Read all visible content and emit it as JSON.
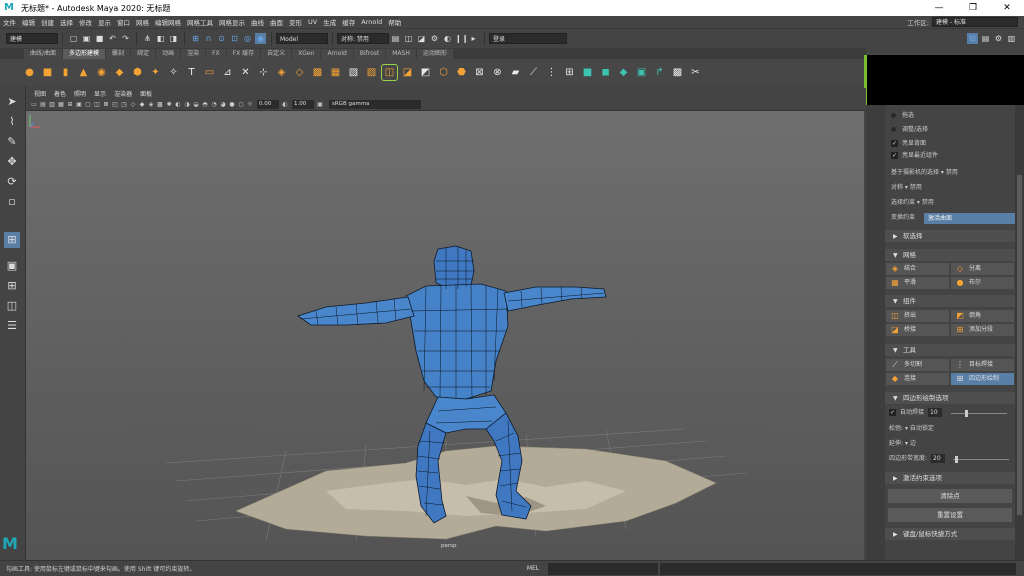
{
  "window": {
    "title": "无标题* - Autodesk Maya 2020: 无标题",
    "logo": "M",
    "minimize": "—",
    "maximize": "❐",
    "close": "✕"
  },
  "menu": [
    "文件",
    "编辑",
    "创建",
    "选择",
    "修改",
    "显示",
    "窗口",
    "网格",
    "编辑网格",
    "网格工具",
    "网格显示",
    "曲线",
    "曲面",
    "变形",
    "UV",
    "生成",
    "缓存",
    "Arnold",
    "帮助"
  ],
  "workspace": {
    "label": "工作区:",
    "value": "建模 - 标准"
  },
  "statusline": {
    "mode": "建模",
    "object_field": "Model",
    "symmetry": "对称: 禁用",
    "login": "登录"
  },
  "shelf_tabs": [
    "曲线/曲面",
    "多边形建模",
    "雕刻",
    "绑定",
    "动画",
    "渲染",
    "FX",
    "FX 缓存",
    "自定义",
    "XGen",
    "Arnold",
    "Bifrost",
    "MASH",
    "运动图形"
  ],
  "active_shelf_tab": 1,
  "viewport": {
    "menu": [
      "视图",
      "着色",
      "照明",
      "显示",
      "渲染器",
      "面板"
    ],
    "field1": "0.00",
    "field2": "1.00",
    "colorspace": "sRGB gamma",
    "camera_label": "persp"
  },
  "panel": {
    "pick_label": "拖选",
    "tweak_label": "调整/选择",
    "highlight_back": "亮显背面",
    "highlight_nearest": "亮显最近组件",
    "camera_select": "基于摄影机的选择",
    "camera_select_val": "禁用",
    "symmetry": "对称",
    "symmetry_val": "禁用",
    "constraint": "选择约束",
    "constraint_val": "禁用",
    "transform_constraint": "变换约束",
    "transform_val": "激活曲面",
    "soft_select": "软选择",
    "section_mesh": "网格",
    "combine": "结合",
    "separate": "分离",
    "smooth": "平滑",
    "boolean": "布尔",
    "section_components": "组件",
    "extrude": "挤出",
    "bevel": "倒角",
    "bridge": "桥接",
    "add_divisions": "添加分段",
    "section_tools": "工具",
    "multicut": "多切割",
    "target_weld": "目标焊接",
    "connect": "连接",
    "quad_draw": "四边形绘制",
    "quad_draw_options": "四边形绘制选项",
    "auto_weld": "自动焊接",
    "auto_weld_val": "10",
    "relax": "松弛:",
    "relax_val": "自动锁定",
    "extend": "延伸:",
    "extend_val": "边",
    "strip_width": "四边形带宽度:",
    "strip_width_val": "20",
    "activation_options": "激活约束选项",
    "clear_points": "清除点",
    "reset_settings": "重置设置",
    "hotkeys": "键盘/鼠标快捷方式"
  },
  "cmdline": {
    "help": "勾画工具: 使用鼠标左键或鼠标中键来勾画。使用 Shift 键可约束旋转。",
    "lang": "MEL"
  },
  "icons": {
    "select": "arrow-select-icon",
    "lasso": "lasso-icon",
    "paint": "paint-select-icon",
    "move": "move-icon",
    "rotate": "rotate-icon",
    "scale": "scale-icon"
  }
}
